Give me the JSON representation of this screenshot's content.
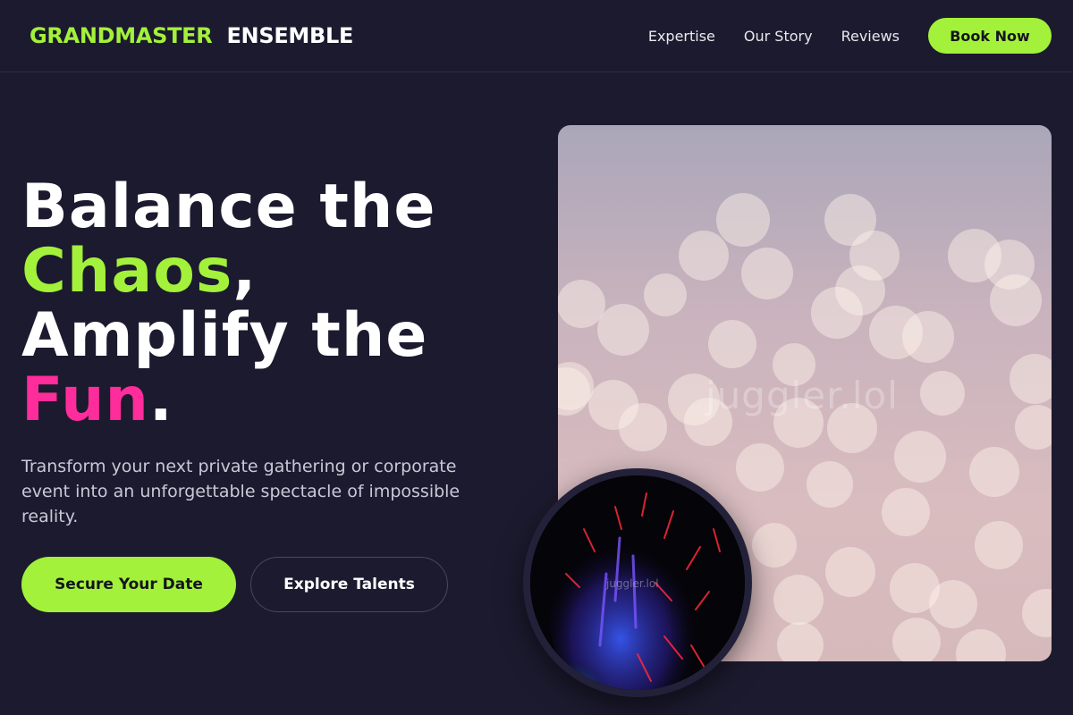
{
  "brand": {
    "part1": "GRANDMASTER",
    "part2": "ENSEMBLE"
  },
  "nav": {
    "links": [
      "Expertise",
      "Our Story",
      "Reviews"
    ],
    "cta": "Book Now"
  },
  "hero": {
    "line1": "Balance the",
    "highlight1": "Chaos",
    "comma": ",",
    "line3": "Amplify the",
    "highlight2": "Fun",
    "period": ".",
    "subtitle": "Transform your next private gathering or corporate event into an unforgettable spectacle of impossible reality.",
    "primary_button": "Secure Your Date",
    "secondary_button": "Explore Talents"
  },
  "media": {
    "main_watermark": "juggler.lol",
    "circle_watermark": "juggler.lol"
  },
  "colors": {
    "background": "#1c1a2e",
    "accent_lime": "#a3f13a",
    "accent_pink": "#ff2d9b"
  }
}
